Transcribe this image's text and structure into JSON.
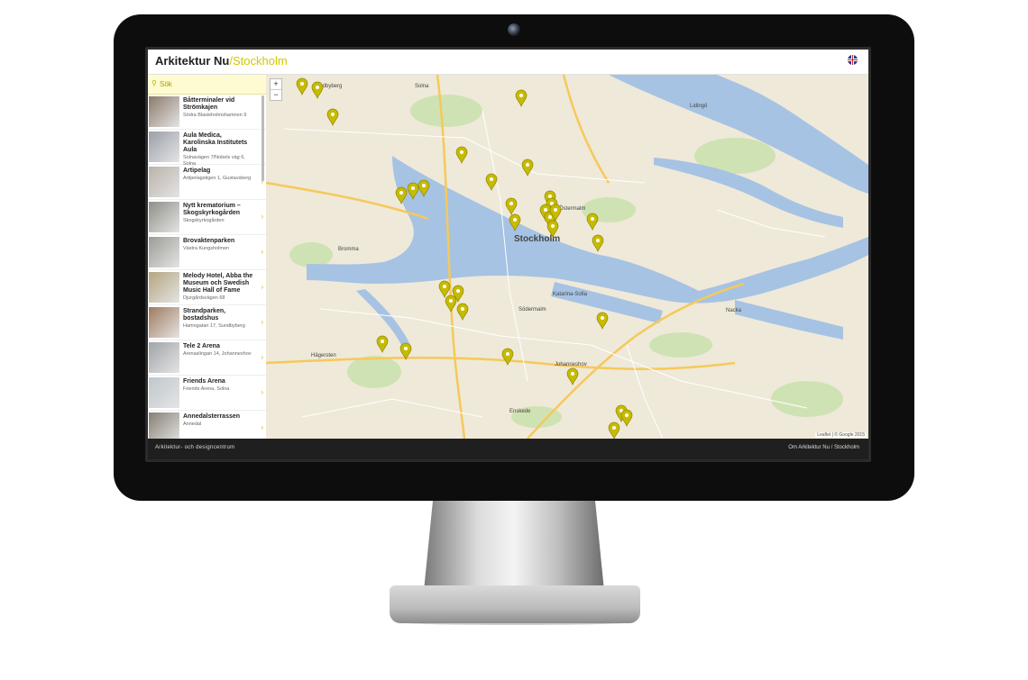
{
  "header": {
    "brand": "Arkitektur Nu",
    "separator": "/",
    "city": "Stockholm"
  },
  "search": {
    "placeholder": "Sök"
  },
  "items": [
    {
      "title": "Båtterminaler vid Strömkajen",
      "address": "Södra Blasieholmshamnen 9"
    },
    {
      "title": "Aula Medica, Karolinska Institutets Aula",
      "address": "Solnavägen 7/Nobels väg 6, Solna"
    },
    {
      "title": "Artipelag",
      "address": "Artipelagstigen 1, Gustavsberg"
    },
    {
      "title": "Nytt krematorium – Skogskyrkogården",
      "address": "Skogskyrkogården"
    },
    {
      "title": "Brovaktenparken",
      "address": "Västra Kungsholmen"
    },
    {
      "title": "Melody Hotel, Abba the Museum och Swedish Music Hall of Fame",
      "address": "Djurgårdsvägen 68"
    },
    {
      "title": "Strandparken, bostadshus",
      "address": "Hamngatan 17, Sundbyberg"
    },
    {
      "title": "Tele 2 Arena",
      "address": "Arenaslingan 14, Johanneshov"
    },
    {
      "title": "Friends Arena",
      "address": "Friends Arena, Solna"
    },
    {
      "title": "Annedalsterrassen",
      "address": "Annedal"
    }
  ],
  "map": {
    "zoom_in": "+",
    "zoom_out": "−",
    "attribution": "Leaflet | © Google 2015",
    "labels": [
      "Stockholm",
      "Solna",
      "Sundbyberg",
      "Lidingö",
      "Östermalm",
      "Katarina-Sofia",
      "Södermalm",
      "Johanneshov",
      "Hägersten",
      "Nacka",
      "Enskede",
      "Bromma"
    ],
    "marker_color": "#c7bb00"
  },
  "footer": {
    "left": "Arkitektur- och designcentrum",
    "right": "Om Arkitektur Nu / Stockholm"
  }
}
